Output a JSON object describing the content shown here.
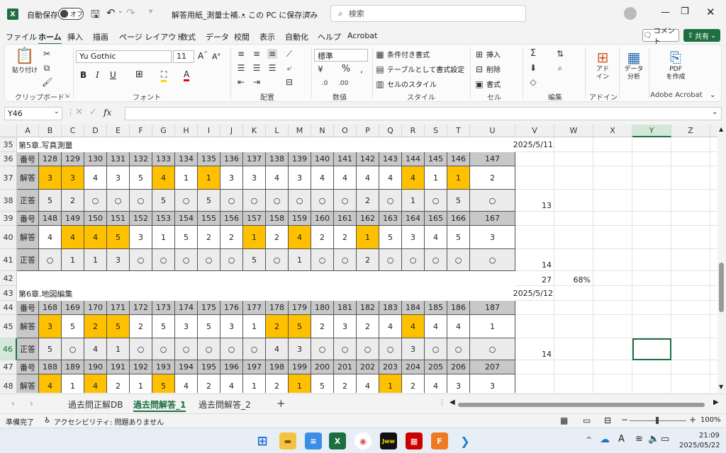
{
  "titlebar": {
    "autosave_label": "自動保存",
    "toggle_label": "オフ",
    "doc_title": "解答用紙_測量士補…",
    "save_location": "• この PC に保存済み",
    "search_placeholder": "検索"
  },
  "menu": [
    "ファイル",
    "ホーム",
    "挿入",
    "描画",
    "ページ レイアウト",
    "数式",
    "データ",
    "校閲",
    "表示",
    "自動化",
    "ヘルプ",
    "Acrobat"
  ],
  "menu_right": {
    "comment": "コメント",
    "share": "共有"
  },
  "ribbon": {
    "paste": "貼り付け",
    "clipboard": "クリップボード",
    "font_name": "Yu Gothic",
    "font_size": "11",
    "font": "フォント",
    "align": "配置",
    "number_format": "標準",
    "number": "数値",
    "cond_format": "条件付き書式",
    "table_format": "テーブルとして書式設定",
    "cell_style": "セルのスタイル",
    "style": "スタイル",
    "insert": "挿入",
    "delete": "削除",
    "format": "書式",
    "cells": "セル",
    "edit": "編集",
    "addin_btn": "アド\nイン",
    "addin": "アドイン",
    "analyze": "データ\n分析",
    "pdf": "PDF\nを作成",
    "acrobat": "Adobe Acrobat"
  },
  "formula_bar": {
    "name_box": "Y46",
    "fx": "fx",
    "content": ""
  },
  "columns": [
    "A",
    "B",
    "C",
    "D",
    "E",
    "F",
    "G",
    "H",
    "I",
    "J",
    "K",
    "L",
    "M",
    "N",
    "O",
    "P",
    "Q",
    "R",
    "S",
    "T",
    "U",
    "V",
    "W",
    "X",
    "Y",
    "Z",
    "A"
  ],
  "rows": [
    "35",
    "36",
    "37",
    "38",
    "39",
    "40",
    "41",
    "42",
    "43",
    "44",
    "45",
    "46",
    "47",
    "48"
  ],
  "sheet": {
    "sec5_title": "第5章.写真測量",
    "sec5_date": "2025/5/11",
    "sec6_title": "第6章.地図編集",
    "sec6_date": "2025/5/12",
    "lbl_num": "番号",
    "lbl_ans": "解答",
    "lbl_cor": "正答",
    "score_38": "13",
    "score_41": "14",
    "total_42": "27",
    "pct_42": "68%",
    "score_46": "14",
    "blocks": [
      {
        "nums": [
          "128",
          "129",
          "130",
          "131",
          "132",
          "133",
          "134",
          "135",
          "136",
          "137",
          "138",
          "139",
          "140",
          "141",
          "142",
          "143",
          "144",
          "145",
          "146",
          "147"
        ],
        "ans": [
          "3",
          "3",
          "4",
          "3",
          "5",
          "4",
          "1",
          "1",
          "3",
          "3",
          "4",
          "3",
          "4",
          "4",
          "4",
          "4",
          "4",
          "1",
          "1",
          "2"
        ],
        "hl": [
          1,
          1,
          0,
          0,
          0,
          1,
          0,
          1,
          0,
          0,
          0,
          0,
          0,
          0,
          0,
          0,
          1,
          0,
          1,
          0
        ],
        "cor": [
          "5",
          "2",
          "○",
          "○",
          "○",
          "5",
          "○",
          "5",
          "○",
          "○",
          "○",
          "○",
          "○",
          "○",
          "2",
          "○",
          "1",
          "○",
          "5",
          "○"
        ]
      },
      {
        "nums": [
          "148",
          "149",
          "150",
          "151",
          "152",
          "153",
          "154",
          "155",
          "156",
          "157",
          "158",
          "159",
          "160",
          "161",
          "162",
          "163",
          "164",
          "165",
          "166",
          "167"
        ],
        "ans": [
          "4",
          "4",
          "4",
          "5",
          "3",
          "1",
          "5",
          "2",
          "2",
          "1",
          "2",
          "4",
          "2",
          "2",
          "1",
          "5",
          "3",
          "4",
          "5",
          "3"
        ],
        "hl": [
          0,
          1,
          1,
          1,
          0,
          0,
          0,
          0,
          0,
          1,
          0,
          1,
          0,
          0,
          1,
          0,
          0,
          0,
          0,
          0
        ],
        "cor": [
          "○",
          "1",
          "1",
          "3",
          "○",
          "○",
          "○",
          "○",
          "○",
          "5",
          "○",
          "1",
          "○",
          "○",
          "2",
          "○",
          "○",
          "○",
          "○",
          "○"
        ]
      },
      {
        "nums": [
          "168",
          "169",
          "170",
          "171",
          "172",
          "173",
          "174",
          "175",
          "176",
          "177",
          "178",
          "179",
          "180",
          "181",
          "182",
          "183",
          "184",
          "185",
          "186",
          "187"
        ],
        "ans": [
          "3",
          "5",
          "2",
          "5",
          "2",
          "5",
          "3",
          "5",
          "3",
          "1",
          "2",
          "5",
          "2",
          "3",
          "2",
          "4",
          "4",
          "4",
          "4",
          "1"
        ],
        "hl": [
          1,
          0,
          1,
          1,
          0,
          0,
          0,
          0,
          0,
          0,
          1,
          1,
          0,
          0,
          0,
          0,
          1,
          0,
          0,
          0
        ],
        "cor": [
          "5",
          "○",
          "4",
          "1",
          "○",
          "○",
          "○",
          "○",
          "○",
          "○",
          "4",
          "3",
          "○",
          "○",
          "○",
          "○",
          "3",
          "○",
          "○",
          "○"
        ]
      },
      {
        "nums": [
          "188",
          "189",
          "190",
          "191",
          "192",
          "193",
          "194",
          "195",
          "196",
          "197",
          "198",
          "199",
          "200",
          "201",
          "202",
          "203",
          "204",
          "205",
          "206",
          "207"
        ],
        "ans": [
          "4",
          "1",
          "4",
          "2",
          "1",
          "5",
          "4",
          "2",
          "4",
          "1",
          "2",
          "1",
          "5",
          "2",
          "4",
          "1",
          "2",
          "4",
          "3",
          "3"
        ],
        "hl": [
          1,
          0,
          1,
          0,
          0,
          1,
          0,
          0,
          0,
          0,
          0,
          1,
          0,
          0,
          0,
          1,
          0,
          0,
          0,
          0
        ],
        "cor": []
      }
    ]
  },
  "tabs": [
    "過去問正解DB",
    "過去問解答_1",
    "過去問解答_2"
  ],
  "active_tab": "過去問解答_1",
  "status": {
    "ready": "準備完了",
    "access": "アクセシビリティ: 問題ありません",
    "zoom": "100%"
  },
  "taskbar": {
    "time": "21:09",
    "date": "2025/05/22"
  }
}
